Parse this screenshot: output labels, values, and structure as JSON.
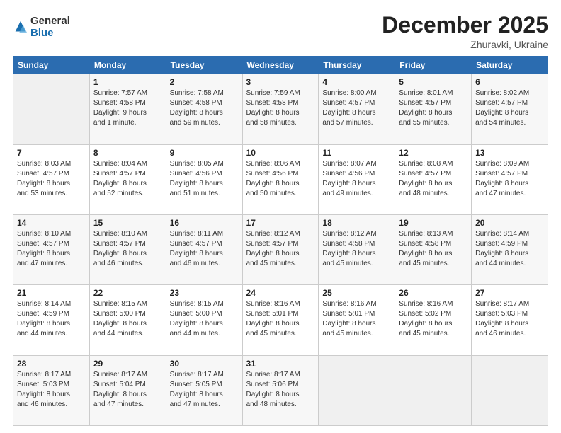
{
  "logo": {
    "general": "General",
    "blue": "Blue"
  },
  "header": {
    "month": "December 2025",
    "location": "Zhuravki, Ukraine"
  },
  "days_header": [
    "Sunday",
    "Monday",
    "Tuesday",
    "Wednesday",
    "Thursday",
    "Friday",
    "Saturday"
  ],
  "weeks": [
    [
      {
        "day": "",
        "info": ""
      },
      {
        "day": "1",
        "info": "Sunrise: 7:57 AM\nSunset: 4:58 PM\nDaylight: 9 hours\nand 1 minute."
      },
      {
        "day": "2",
        "info": "Sunrise: 7:58 AM\nSunset: 4:58 PM\nDaylight: 8 hours\nand 59 minutes."
      },
      {
        "day": "3",
        "info": "Sunrise: 7:59 AM\nSunset: 4:58 PM\nDaylight: 8 hours\nand 58 minutes."
      },
      {
        "day": "4",
        "info": "Sunrise: 8:00 AM\nSunset: 4:57 PM\nDaylight: 8 hours\nand 57 minutes."
      },
      {
        "day": "5",
        "info": "Sunrise: 8:01 AM\nSunset: 4:57 PM\nDaylight: 8 hours\nand 55 minutes."
      },
      {
        "day": "6",
        "info": "Sunrise: 8:02 AM\nSunset: 4:57 PM\nDaylight: 8 hours\nand 54 minutes."
      }
    ],
    [
      {
        "day": "7",
        "info": "Sunrise: 8:03 AM\nSunset: 4:57 PM\nDaylight: 8 hours\nand 53 minutes."
      },
      {
        "day": "8",
        "info": "Sunrise: 8:04 AM\nSunset: 4:57 PM\nDaylight: 8 hours\nand 52 minutes."
      },
      {
        "day": "9",
        "info": "Sunrise: 8:05 AM\nSunset: 4:56 PM\nDaylight: 8 hours\nand 51 minutes."
      },
      {
        "day": "10",
        "info": "Sunrise: 8:06 AM\nSunset: 4:56 PM\nDaylight: 8 hours\nand 50 minutes."
      },
      {
        "day": "11",
        "info": "Sunrise: 8:07 AM\nSunset: 4:56 PM\nDaylight: 8 hours\nand 49 minutes."
      },
      {
        "day": "12",
        "info": "Sunrise: 8:08 AM\nSunset: 4:57 PM\nDaylight: 8 hours\nand 48 minutes."
      },
      {
        "day": "13",
        "info": "Sunrise: 8:09 AM\nSunset: 4:57 PM\nDaylight: 8 hours\nand 47 minutes."
      }
    ],
    [
      {
        "day": "14",
        "info": "Sunrise: 8:10 AM\nSunset: 4:57 PM\nDaylight: 8 hours\nand 47 minutes."
      },
      {
        "day": "15",
        "info": "Sunrise: 8:10 AM\nSunset: 4:57 PM\nDaylight: 8 hours\nand 46 minutes."
      },
      {
        "day": "16",
        "info": "Sunrise: 8:11 AM\nSunset: 4:57 PM\nDaylight: 8 hours\nand 46 minutes."
      },
      {
        "day": "17",
        "info": "Sunrise: 8:12 AM\nSunset: 4:57 PM\nDaylight: 8 hours\nand 45 minutes."
      },
      {
        "day": "18",
        "info": "Sunrise: 8:12 AM\nSunset: 4:58 PM\nDaylight: 8 hours\nand 45 minutes."
      },
      {
        "day": "19",
        "info": "Sunrise: 8:13 AM\nSunset: 4:58 PM\nDaylight: 8 hours\nand 45 minutes."
      },
      {
        "day": "20",
        "info": "Sunrise: 8:14 AM\nSunset: 4:59 PM\nDaylight: 8 hours\nand 44 minutes."
      }
    ],
    [
      {
        "day": "21",
        "info": "Sunrise: 8:14 AM\nSunset: 4:59 PM\nDaylight: 8 hours\nand 44 minutes."
      },
      {
        "day": "22",
        "info": "Sunrise: 8:15 AM\nSunset: 5:00 PM\nDaylight: 8 hours\nand 44 minutes."
      },
      {
        "day": "23",
        "info": "Sunrise: 8:15 AM\nSunset: 5:00 PM\nDaylight: 8 hours\nand 44 minutes."
      },
      {
        "day": "24",
        "info": "Sunrise: 8:16 AM\nSunset: 5:01 PM\nDaylight: 8 hours\nand 45 minutes."
      },
      {
        "day": "25",
        "info": "Sunrise: 8:16 AM\nSunset: 5:01 PM\nDaylight: 8 hours\nand 45 minutes."
      },
      {
        "day": "26",
        "info": "Sunrise: 8:16 AM\nSunset: 5:02 PM\nDaylight: 8 hours\nand 45 minutes."
      },
      {
        "day": "27",
        "info": "Sunrise: 8:17 AM\nSunset: 5:03 PM\nDaylight: 8 hours\nand 46 minutes."
      }
    ],
    [
      {
        "day": "28",
        "info": "Sunrise: 8:17 AM\nSunset: 5:03 PM\nDaylight: 8 hours\nand 46 minutes."
      },
      {
        "day": "29",
        "info": "Sunrise: 8:17 AM\nSunset: 5:04 PM\nDaylight: 8 hours\nand 47 minutes."
      },
      {
        "day": "30",
        "info": "Sunrise: 8:17 AM\nSunset: 5:05 PM\nDaylight: 8 hours\nand 47 minutes."
      },
      {
        "day": "31",
        "info": "Sunrise: 8:17 AM\nSunset: 5:06 PM\nDaylight: 8 hours\nand 48 minutes."
      },
      {
        "day": "",
        "info": ""
      },
      {
        "day": "",
        "info": ""
      },
      {
        "day": "",
        "info": ""
      }
    ]
  ]
}
